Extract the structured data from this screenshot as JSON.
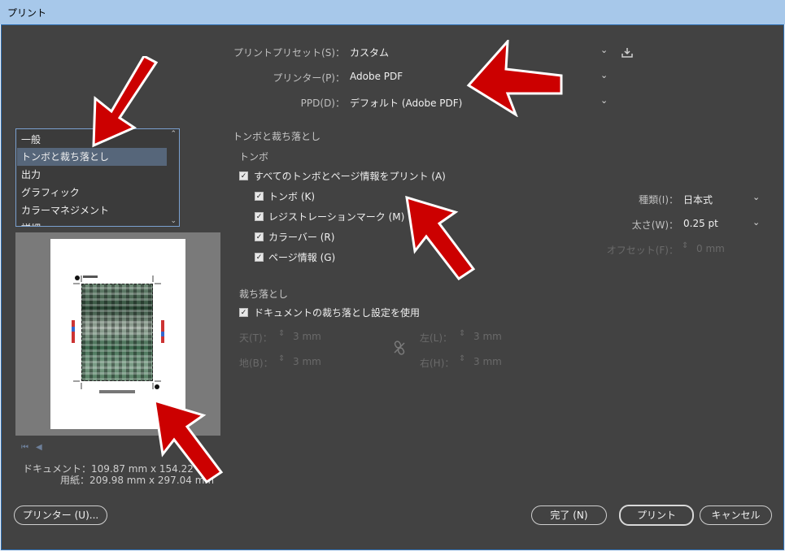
{
  "window": {
    "title": "プリント"
  },
  "presets": [
    {
      "label": "プリントプリセット(S)：",
      "value": "カスタム"
    },
    {
      "label": "プリンター(P)：",
      "value": "Adobe PDF"
    },
    {
      "label": "PPD(D)：",
      "value": "デフォルト (Adobe PDF)"
    }
  ],
  "categories": [
    "一般",
    "トンボと裁ち落とし",
    "出力",
    "グラフィック",
    "カラーマネジメント",
    "詳細"
  ],
  "section": {
    "title": "トンボと裁ち落とし",
    "marks_title": "トンボ",
    "all_marks": "すべてのトンボとページ情報をプリント (A)",
    "marks": [
      "トンボ (K)",
      "レジストレーションマーク (M)",
      "カラーバー (R)",
      "ページ情報 (G)"
    ],
    "type_label": "種類(I)：",
    "type_value": "日本式",
    "weight_label": "太さ(W)：",
    "weight_value": "0.25 pt",
    "offset_label": "オフセット(F)：",
    "offset_value": "0 mm",
    "bleed_title": "裁ち落とし",
    "use_doc_bleed": "ドキュメントの裁ち落とし設定を使用",
    "bleed": [
      {
        "label": "天(T)：",
        "value": "3 mm"
      },
      {
        "label": "地(B)：",
        "value": "3 mm"
      },
      {
        "label": "左(L)：",
        "value": "3 mm"
      },
      {
        "label": "右(H)：",
        "value": "3 mm"
      }
    ]
  },
  "info": {
    "document": "ドキュメント：109.87 mm x 154.22",
    "paper": "用紙：209.98 mm x 297.04 mm"
  },
  "buttons": {
    "printer": "プリンター (U)...",
    "done": "完了 (N)",
    "print": "プリント",
    "cancel": "キャンセル"
  },
  "icons": {
    "save_preset": "save-download-icon",
    "link": "chain-link-icon",
    "chevron": "chevron-down-icon",
    "arrow_color": "#cc0000"
  }
}
